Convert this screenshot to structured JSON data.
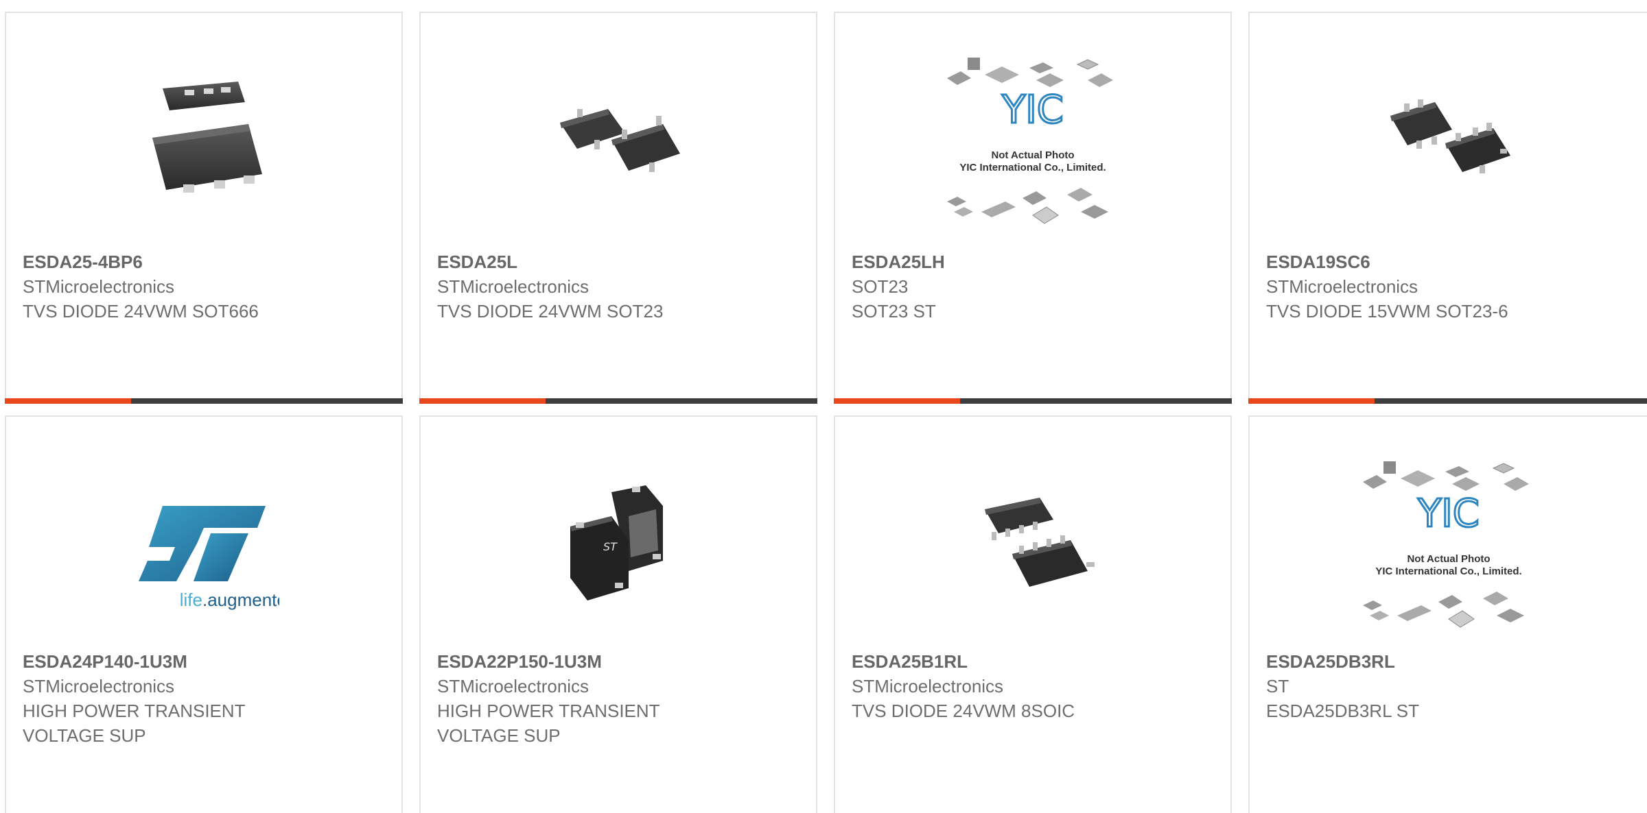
{
  "products": [
    {
      "part": "ESDA25-4BP6",
      "line1": "STMicroelectronics",
      "line2": "TVS DIODE 24VWM SOT666",
      "line3": "",
      "image": "sot666-package-icon"
    },
    {
      "part": "ESDA25L",
      "line1": "STMicroelectronics",
      "line2": "TVS DIODE 24VWM SOT23",
      "line3": "",
      "image": "sot23-package-icon"
    },
    {
      "part": "ESDA25LH",
      "line1": "SOT23",
      "line2": "SOT23 ST",
      "line3": "",
      "image": "not-actual-photo-placeholder"
    },
    {
      "part": "ESDA19SC6",
      "line1": "STMicroelectronics",
      "line2": "TVS DIODE 15VWM SOT23-6",
      "line3": "",
      "image": "sot23-6-package-icon"
    },
    {
      "part": "ESDA24P140-1U3M",
      "line1": "STMicroelectronics",
      "line2": "HIGH POWER TRANSIENT",
      "line3": "VOLTAGE SUP",
      "image": "st-logo"
    },
    {
      "part": "ESDA22P150-1U3M",
      "line1": "STMicroelectronics",
      "line2": "HIGH POWER TRANSIENT",
      "line3": "VOLTAGE SUP",
      "image": "qfn-package-icon"
    },
    {
      "part": "ESDA25B1RL",
      "line1": "STMicroelectronics",
      "line2": "TVS DIODE 24VWM 8SOIC",
      "line3": "",
      "image": "soic8-package-icon"
    },
    {
      "part": "ESDA25DB3RL",
      "line1": "ST",
      "line2": "ESDA25DB3RL ST",
      "line3": "",
      "image": "not-actual-photo-placeholder"
    }
  ],
  "placeholder": {
    "line1": "Not Actual Photo",
    "line2": "YIC International Co., Limited.",
    "logo": "YIC"
  },
  "st_logo": {
    "tagline_a": "life",
    "tagline_b": ".augmented"
  },
  "colors": {
    "accent": "#e8481c",
    "bar": "#3e3e3e",
    "border": "#e2e2e2",
    "text": "#6d6d6d"
  }
}
